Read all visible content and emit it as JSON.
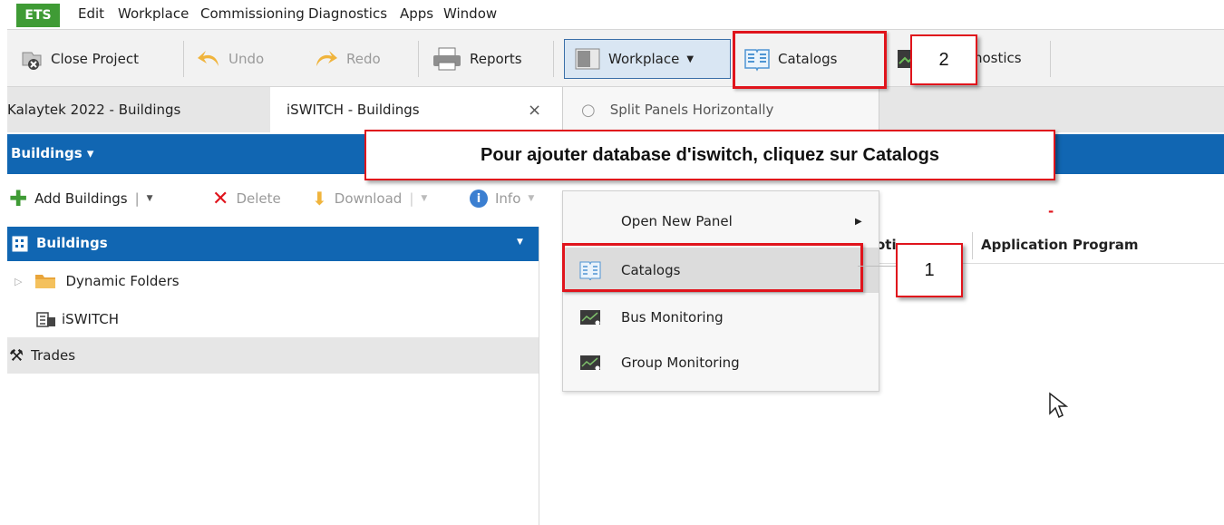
{
  "app": {
    "ets_label": "ETS"
  },
  "menu": [
    "Edit",
    "Workplace",
    "Commissioning",
    "Diagnostics",
    "Apps",
    "Window"
  ],
  "toolbar": {
    "close_project": "Close Project",
    "undo": "Undo",
    "redo": "Redo",
    "reports": "Reports",
    "workplace": "Workplace",
    "catalogs": "Catalogs",
    "diagnostics_partial": "nostics"
  },
  "tabs": {
    "tab1": "Kalaytek 2022 - Buildings",
    "tab2": "iSWITCH - Buildings",
    "close": "×"
  },
  "split_panels": "Split Panels Horizontally",
  "blue_header": {
    "title": "Buildings ▾"
  },
  "toolbar2": {
    "add": "Add Buildings",
    "delete": "Delete",
    "download": "Download",
    "info": "Info"
  },
  "left_panel": {
    "header": "Buildings",
    "dynamic_folders": "Dynamic Folders",
    "iswitch": "iSWITCH",
    "trades": "Trades"
  },
  "grid": {
    "col_partial": "oti",
    "col_app": "Application Program"
  },
  "dropdown": {
    "open_new_panel": "Open New Panel",
    "catalogs": "Catalogs",
    "bus_monitoring": "Bus Monitoring",
    "group_monitoring": "Group Monitoring"
  },
  "annotations": {
    "banner": "Pour ajouter database d'iswitch, cliquez sur Catalogs",
    "step1": "1",
    "step2": "2"
  },
  "colors": {
    "accent_blue": "#1166b2",
    "ets_green": "#3f9b35",
    "annotation_red": "#e0141c"
  }
}
